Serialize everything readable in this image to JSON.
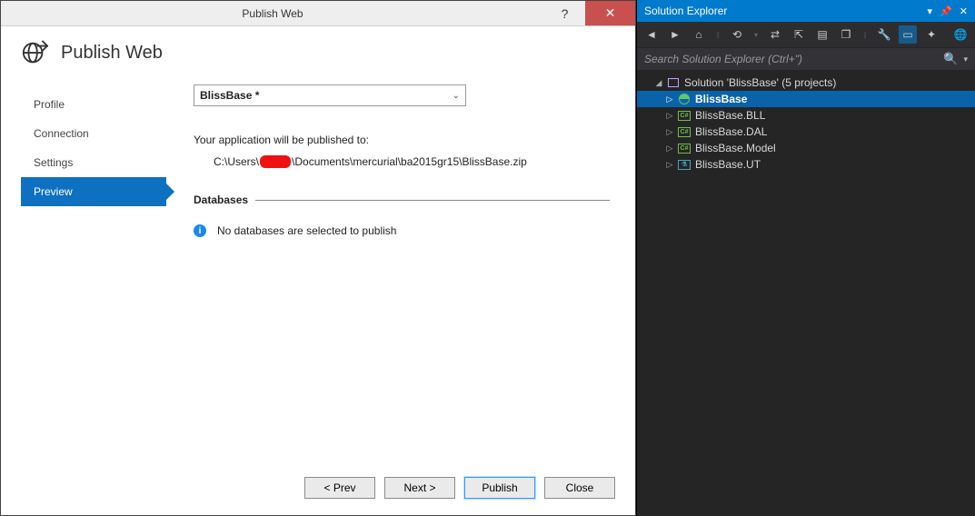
{
  "dialog": {
    "window_title": "Publish Web",
    "header_title": "Publish Web",
    "nav": {
      "profile": "Profile",
      "connection": "Connection",
      "settings": "Settings",
      "preview": "Preview"
    },
    "dropdown_value": "BlissBase *",
    "publish_label": "Your application will be published to:",
    "path_pre": "C:\\Users\\",
    "path_post": "\\Documents\\mercurial\\ba2015gr15\\BlissBase.zip",
    "databases_heading": "Databases",
    "no_db_msg": "No databases are selected to publish",
    "buttons": {
      "prev": "< Prev",
      "next": "Next >",
      "publish": "Publish",
      "close": "Close"
    }
  },
  "solution_explorer": {
    "title": "Solution Explorer",
    "search_placeholder": "Search Solution Explorer (Ctrl+\")",
    "solution_label": "Solution 'BlissBase' (5 projects)",
    "projects": {
      "p0": "BlissBase",
      "p1": "BlissBase.BLL",
      "p2": "BlissBase.DAL",
      "p3": "BlissBase.Model",
      "p4": "BlissBase.UT"
    }
  }
}
